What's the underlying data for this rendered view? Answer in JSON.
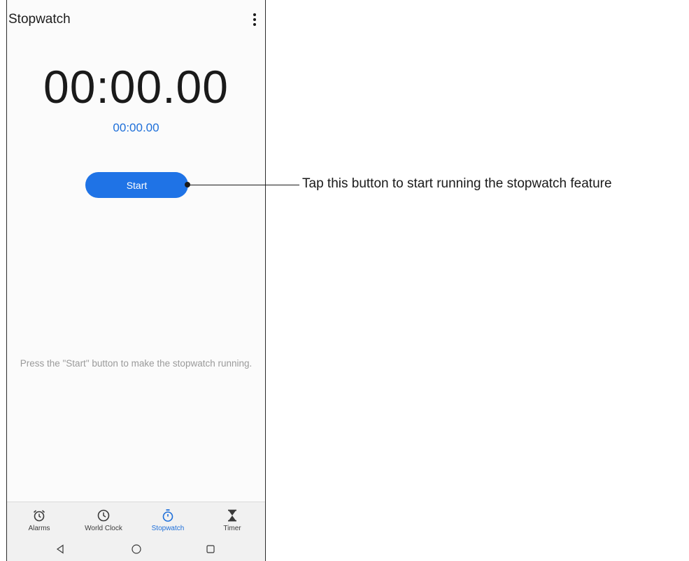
{
  "app": {
    "title": "Stopwatch"
  },
  "stopwatch": {
    "main_time": "00:00.00",
    "lap_time": "00:00.00",
    "start_label": "Start",
    "hint": "Press the \"Start\" button to make the stopwatch running."
  },
  "bottom_nav": {
    "items": [
      {
        "label": "Alarms",
        "icon": "alarm-icon"
      },
      {
        "label": "World Clock",
        "icon": "clock-icon"
      },
      {
        "label": "Stopwatch",
        "icon": "stopwatch-icon",
        "active": true
      },
      {
        "label": "Timer",
        "icon": "hourglass-icon"
      }
    ]
  },
  "system_nav": {
    "icons": [
      "back-icon",
      "home-icon",
      "recents-icon"
    ]
  },
  "annotation": {
    "text": "Tap this button to start running the stopwatch feature"
  },
  "colors": {
    "accent": "#1f73e6",
    "text_accent": "#1e6fd9",
    "hint": "#9a9a9a"
  }
}
